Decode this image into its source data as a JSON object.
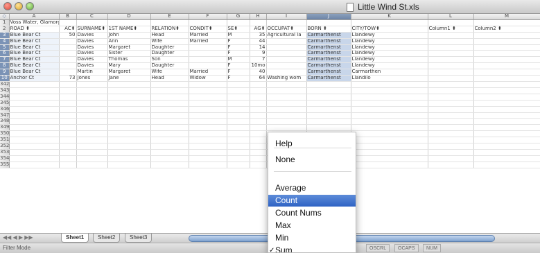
{
  "window": {
    "title": "Little Wind St.xls"
  },
  "sheet": {
    "corner_glyph": "◇",
    "columns": [
      "A",
      "B",
      "C",
      "D",
      "E",
      "F",
      "G",
      "H",
      "I",
      "J",
      "K",
      "L",
      "M"
    ],
    "selected_column": "J",
    "rows": [
      {
        "num": "1",
        "cells": [
          "Voss Water, Glamorgan, Swansea, District 1",
          "",
          "",
          "",
          "",
          "",
          "",
          "",
          "",
          "",
          "",
          "",
          ""
        ]
      },
      {
        "num": "2",
        "cells": [
          "ROAD ⬍",
          "AC⬍",
          "SURNAME⬍",
          "1ST NAME⬍",
          "RELATION⬍",
          "CONDIT⬍",
          "SE⬍",
          "AG⬍",
          "OCCUPAT⬍",
          "BORN ⬍",
          "CITY/TOW⬍",
          "Column1 ⬍",
          "Column2 ⬍"
        ]
      },
      {
        "num": "3",
        "cells": [
          "Blue Bear Ct",
          "50",
          "Davies",
          "John",
          "Head",
          "Married",
          "M",
          "35",
          "Agricultural la",
          "Carmarthenst",
          "Llandewy",
          "",
          ""
        ]
      },
      {
        "num": "4",
        "cells": [
          "Blue Bear Ct",
          "",
          "Davies",
          "Ann",
          "Wife",
          "Married",
          "F",
          "44",
          "",
          "Carmarthenst",
          "Llandewy",
          "",
          ""
        ]
      },
      {
        "num": "5",
        "cells": [
          "Blue Bear Ct",
          "",
          "Davies",
          "Margaret",
          "Daughter",
          "",
          "F",
          "14",
          "",
          "Carmarthenst",
          "Llandewy",
          "",
          ""
        ]
      },
      {
        "num": "6",
        "cells": [
          "Blue Bear Ct",
          "",
          "Davies",
          "Sister",
          "Daughter",
          "",
          "F",
          "9",
          "",
          "Carmarthenst",
          "Llandewy",
          "",
          ""
        ]
      },
      {
        "num": "7",
        "cells": [
          "Blue Bear Ct",
          "",
          "Davies",
          "Thomas",
          "Son",
          "",
          "M",
          "7",
          "",
          "Carmarthenst",
          "Llandewy",
          "",
          ""
        ]
      },
      {
        "num": "8",
        "cells": [
          "Blue Bear Ct",
          "",
          "Davies",
          "Mary",
          "Daughter",
          "",
          "F",
          "10mo",
          "",
          "Carmarthenst",
          "Llandewy",
          "",
          ""
        ]
      },
      {
        "num": "9",
        "cells": [
          "Blue Bear Ct",
          "",
          "Martin",
          "Margaret",
          "Wife",
          "Married",
          "F",
          "40",
          "",
          "Carmarthenst",
          "Carmarthen",
          "",
          ""
        ]
      },
      {
        "num": "10",
        "cells": [
          "Anchor Ct",
          "73",
          "Jones",
          "Jane",
          "Head",
          "Widow",
          "F",
          "64",
          "Washing wom",
          "Carmarthenst",
          "Llandilo",
          "",
          ""
        ]
      },
      {
        "num": "342",
        "cells": [
          "",
          "",
          "",
          "",
          "",
          "",
          "",
          "",
          "",
          "",
          "",
          "",
          ""
        ]
      },
      {
        "num": "343",
        "cells": [
          "",
          "",
          "",
          "",
          "",
          "",
          "",
          "",
          "",
          "",
          "",
          "",
          ""
        ]
      },
      {
        "num": "344",
        "cells": [
          "",
          "",
          "",
          "",
          "",
          "",
          "",
          "",
          "",
          "",
          "",
          "",
          ""
        ]
      },
      {
        "num": "345",
        "cells": [
          "",
          "",
          "",
          "",
          "",
          "",
          "",
          "",
          "",
          "",
          "",
          "",
          ""
        ]
      },
      {
        "num": "346",
        "cells": [
          "",
          "",
          "",
          "",
          "",
          "",
          "",
          "",
          "",
          "",
          "",
          "",
          ""
        ]
      },
      {
        "num": "347",
        "cells": [
          "",
          "",
          "",
          "",
          "",
          "",
          "",
          "",
          "",
          "",
          "",
          "",
          ""
        ]
      },
      {
        "num": "348",
        "cells": [
          "",
          "",
          "",
          "",
          "",
          "",
          "",
          "",
          "",
          "",
          "",
          "",
          ""
        ]
      },
      {
        "num": "349",
        "cells": [
          "",
          "",
          "",
          "",
          "",
          "",
          "",
          "",
          "",
          "",
          "",
          "",
          ""
        ]
      },
      {
        "num": "350",
        "cells": [
          "",
          "",
          "",
          "",
          "",
          "",
          "",
          "",
          "",
          "",
          "",
          "",
          ""
        ]
      },
      {
        "num": "351",
        "cells": [
          "",
          "",
          "",
          "",
          "",
          "",
          "",
          "",
          "",
          "",
          "",
          "",
          ""
        ]
      },
      {
        "num": "352",
        "cells": [
          "",
          "",
          "",
          "",
          "",
          "",
          "",
          "",
          "",
          "",
          "",
          "",
          ""
        ]
      },
      {
        "num": "353",
        "cells": [
          "",
          "",
          "",
          "",
          "",
          "",
          "",
          "",
          "",
          "",
          "",
          "",
          ""
        ]
      },
      {
        "num": "354",
        "cells": [
          "",
          "",
          "",
          "",
          "",
          "",
          "",
          "",
          "",
          "",
          "",
          "",
          ""
        ]
      },
      {
        "num": "355",
        "cells": [
          "",
          "",
          "",
          "",
          "",
          "",
          "",
          "",
          "",
          "",
          "",
          "",
          ""
        ]
      }
    ]
  },
  "tabs": {
    "nav_glyphs": "◀◀ ◀ ▶ ▶▶",
    "items": [
      "Sheet1",
      "Sheet2",
      "Sheet3"
    ],
    "active_index": 0
  },
  "status": {
    "text": "Filter Mode",
    "indicators": [
      "OSCRL",
      "OCAPS",
      "NUM"
    ]
  },
  "menu": {
    "items": [
      {
        "label": "Help"
      },
      {
        "label": "None"
      },
      {
        "label": "Average"
      },
      {
        "label": "Count",
        "highlighted": true
      },
      {
        "label": "Count Nums"
      },
      {
        "label": "Max"
      },
      {
        "label": "Min"
      },
      {
        "label": "Sum",
        "checked": true
      }
    ],
    "check_glyph": "✓"
  },
  "colors": {
    "selection": "#7b93b6",
    "menu_highlight": "#3b6fcf"
  }
}
